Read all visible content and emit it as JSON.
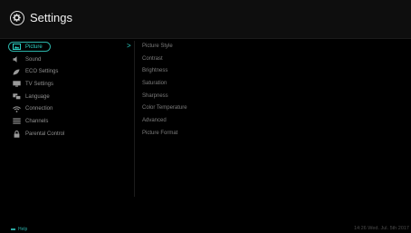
{
  "header": {
    "title": "Settings",
    "icon": "gear-icon"
  },
  "menu": {
    "items": [
      {
        "label": "Picture",
        "icon": "picture-icon",
        "selected": true
      },
      {
        "label": "Sound",
        "icon": "speaker-icon",
        "selected": false
      },
      {
        "label": "ECO Settings",
        "icon": "leaf-icon",
        "selected": false
      },
      {
        "label": "TV Settings",
        "icon": "tv-icon",
        "selected": false
      },
      {
        "label": "Language",
        "icon": "language-icon",
        "selected": false
      },
      {
        "label": "Connection",
        "icon": "wifi-icon",
        "selected": false
      },
      {
        "label": "Channels",
        "icon": "list-icon",
        "selected": false
      },
      {
        "label": "Parental Control",
        "icon": "lock-icon",
        "selected": false
      }
    ],
    "selected_chevron": ">"
  },
  "submenu": {
    "items": [
      {
        "label": "Picture Style"
      },
      {
        "label": "Contrast"
      },
      {
        "label": "Brightness"
      },
      {
        "label": "Saturation"
      },
      {
        "label": "Sharpness"
      },
      {
        "label": "Color Temperature"
      },
      {
        "label": "Advanced"
      },
      {
        "label": "Picture Format"
      }
    ]
  },
  "footer": {
    "help_label": "Help",
    "clock": "14:26 Wed. Jul. 5th 2017"
  },
  "colors": {
    "accent": "#2bd3c6",
    "background": "#000000",
    "text": "#8f8f8f"
  }
}
